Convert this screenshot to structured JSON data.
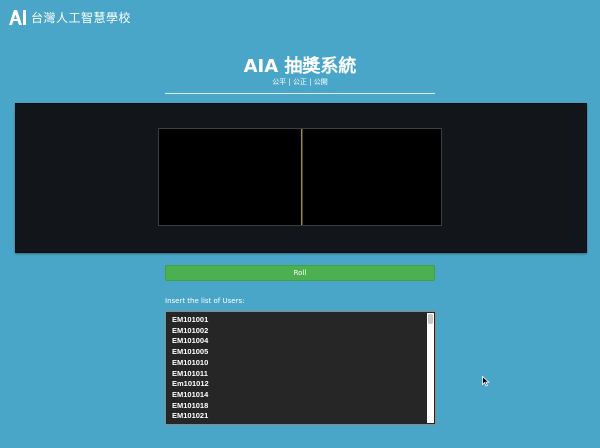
{
  "header": {
    "logo_text": "台灣人工智慧學校"
  },
  "page": {
    "title": "AIA 抽獎系統",
    "subtitle": "公平 | 公正 | 公開"
  },
  "controls": {
    "roll_label": "Roll"
  },
  "users": {
    "label": "Insert the list of Users:",
    "items": [
      "EM101001",
      "EM101002",
      "EM101004",
      "EM101005",
      "EM101010",
      "EM101011",
      "Em101012",
      "EM101014",
      "EM101018",
      "EM101021"
    ]
  },
  "colors": {
    "background": "#4aa6c9",
    "machine": "#12161b",
    "roll_button": "#4caf50",
    "reel_divider": "#b38a2a",
    "textarea": "#262626"
  }
}
